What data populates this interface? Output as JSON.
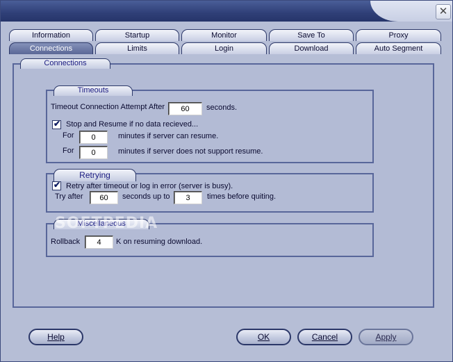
{
  "titlebar": {
    "close_glyph": "✕",
    "close_icon": "close-icon"
  },
  "tabs_row1": [
    {
      "label": "Information"
    },
    {
      "label": "Startup"
    },
    {
      "label": "Monitor"
    },
    {
      "label": "Save To"
    },
    {
      "label": "Proxy"
    }
  ],
  "tabs_row2": [
    {
      "label": "Connections",
      "active": true
    },
    {
      "label": "Limits"
    },
    {
      "label": "Login"
    },
    {
      "label": "Download"
    },
    {
      "label": "Auto Segment"
    }
  ],
  "panel": {
    "title": "Connections"
  },
  "timeouts": {
    "title": "Timeouts",
    "connect_label": "Timeout Connection Attempt After",
    "connect_value": "60",
    "connect_unit": "seconds.",
    "stop_resume_checked": true,
    "stop_resume_label": "Stop and Resume if no data recieved...",
    "for_label": "For",
    "resume_value": "0",
    "resume_label": "minutes if server can resume.",
    "noresume_value": "0",
    "noresume_label": "minutes if server does not support resume."
  },
  "retrying": {
    "title": "Retrying",
    "retry_checked": true,
    "retry_label": "Retry after timeout or log in error (server is busy).",
    "try_after_label": "Try after",
    "seconds_value": "60",
    "seconds_label": "seconds up to",
    "times_value": "3",
    "times_label": "times before quiting."
  },
  "misc": {
    "title": "Miscellaneous",
    "rollback_label": "Rollback",
    "rollback_value": "4",
    "rollback_suffix": "K on resuming download."
  },
  "watermark": "SOFTPEDIA",
  "buttons": {
    "help": "Help",
    "ok": "OK",
    "cancel": "Cancel",
    "apply": "Apply"
  },
  "colors": {
    "accent": "#2b3768",
    "panel": "#b3bbd5",
    "active_tab": "#5a6796"
  }
}
